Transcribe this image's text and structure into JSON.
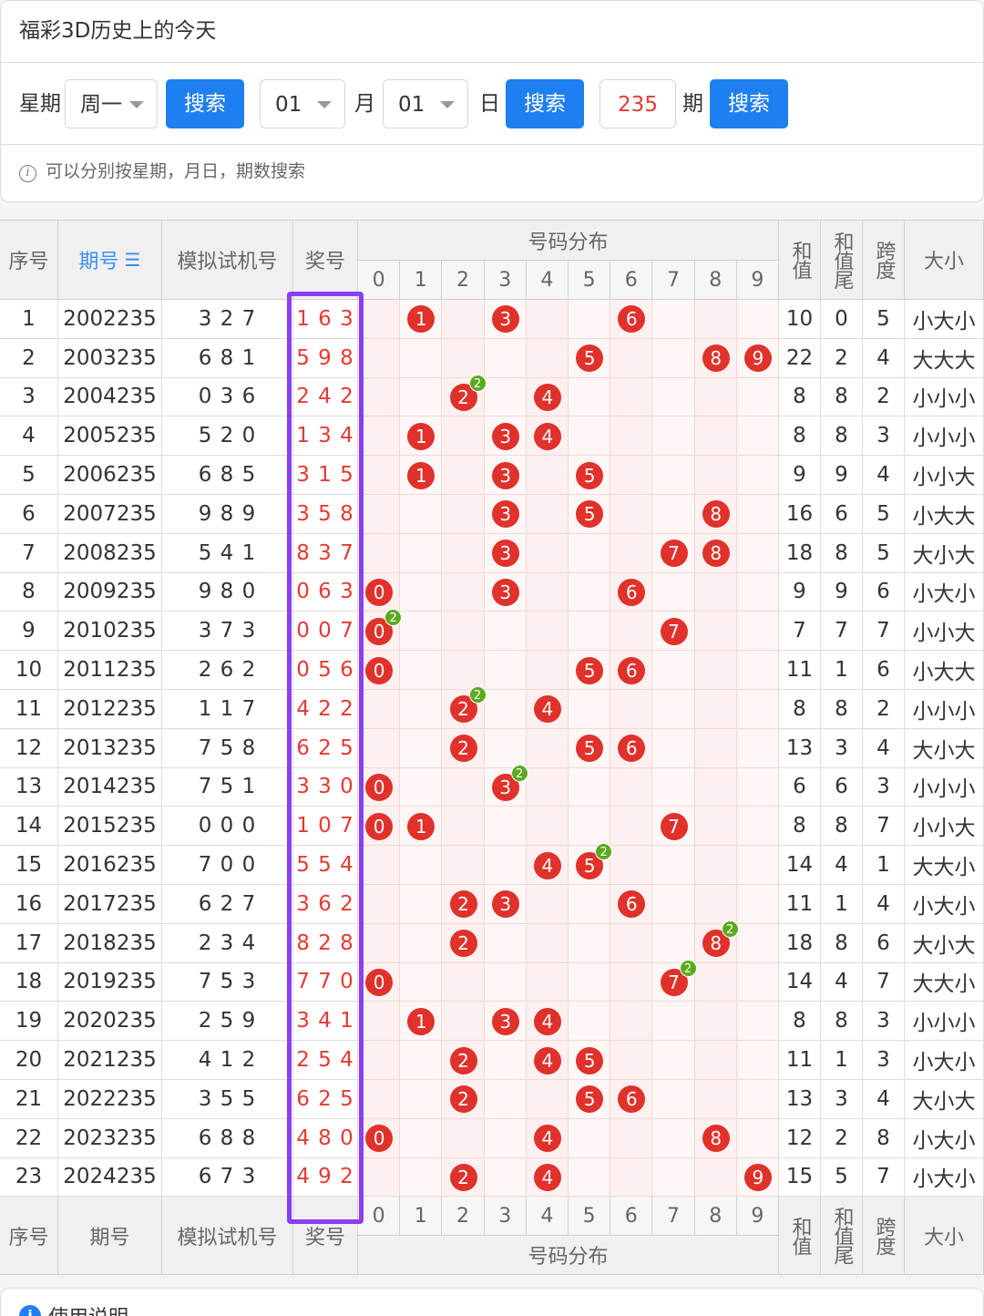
{
  "panel": {
    "title": "福彩3D历史上的今天",
    "weekday_label": "星期",
    "weekday_value": "周一",
    "search_label": "搜索",
    "month_value": "01",
    "month_label": "月",
    "day_value": "01",
    "day_label": "日",
    "issue_value": "235",
    "issue_label": "期",
    "hint": "可以分别按星期，月日，期数搜索"
  },
  "table": {
    "headers": {
      "seq": "序号",
      "issue": "期号",
      "sort_icon": "sort-icon",
      "trial": "模拟试机号",
      "prize": "奖号",
      "dist": "号码分布",
      "digits": [
        "0",
        "1",
        "2",
        "3",
        "4",
        "5",
        "6",
        "7",
        "8",
        "9"
      ],
      "sum": "和值",
      "sum_tail": "和值尾",
      "span": "跨度",
      "size": "大小"
    },
    "footer_headers": {
      "seq": "序号",
      "issue": "期号",
      "trial": "模拟试机号",
      "prize": "奖号",
      "dist": "号码分布",
      "sum": "和值",
      "sum_tail": "和值尾",
      "span": "跨度",
      "size": "大小"
    },
    "rows": [
      {
        "seq": "1",
        "issue": "2002235",
        "trial": "3 2 7",
        "prize": "1 6 3",
        "balls": [
          1,
          3,
          6
        ],
        "badges": [],
        "sum": "10",
        "tail": "0",
        "span": "5",
        "size": "小大小"
      },
      {
        "seq": "2",
        "issue": "2003235",
        "trial": "6 8 1",
        "prize": "5 9 8",
        "balls": [
          5,
          8,
          9
        ],
        "badges": [],
        "sum": "22",
        "tail": "2",
        "span": "4",
        "size": "大大大"
      },
      {
        "seq": "3",
        "issue": "2004235",
        "trial": "0 3 6",
        "prize": "2 4 2",
        "balls": [
          2,
          4
        ],
        "badges": [
          2
        ],
        "sum": "8",
        "tail": "8",
        "span": "2",
        "size": "小小小"
      },
      {
        "seq": "4",
        "issue": "2005235",
        "trial": "5 2 0",
        "prize": "1 3 4",
        "balls": [
          1,
          3,
          4
        ],
        "badges": [],
        "sum": "8",
        "tail": "8",
        "span": "3",
        "size": "小小小"
      },
      {
        "seq": "5",
        "issue": "2006235",
        "trial": "6 8 5",
        "prize": "3 1 5",
        "balls": [
          1,
          3,
          5
        ],
        "badges": [],
        "sum": "9",
        "tail": "9",
        "span": "4",
        "size": "小小大"
      },
      {
        "seq": "6",
        "issue": "2007235",
        "trial": "9 8 9",
        "prize": "3 5 8",
        "balls": [
          3,
          5,
          8
        ],
        "badges": [],
        "sum": "16",
        "tail": "6",
        "span": "5",
        "size": "小大大"
      },
      {
        "seq": "7",
        "issue": "2008235",
        "trial": "5 4 1",
        "prize": "8 3 7",
        "balls": [
          3,
          7,
          8
        ],
        "badges": [],
        "sum": "18",
        "tail": "8",
        "span": "5",
        "size": "大小大"
      },
      {
        "seq": "8",
        "issue": "2009235",
        "trial": "9 8 0",
        "prize": "0 6 3",
        "balls": [
          0,
          3,
          6
        ],
        "badges": [],
        "sum": "9",
        "tail": "9",
        "span": "6",
        "size": "小大小"
      },
      {
        "seq": "9",
        "issue": "2010235",
        "trial": "3 7 3",
        "prize": "0 0 7",
        "balls": [
          0,
          7
        ],
        "badges": [
          0
        ],
        "sum": "7",
        "tail": "7",
        "span": "7",
        "size": "小小大"
      },
      {
        "seq": "10",
        "issue": "2011235",
        "trial": "2 6 2",
        "prize": "0 5 6",
        "balls": [
          0,
          5,
          6
        ],
        "badges": [],
        "sum": "11",
        "tail": "1",
        "span": "6",
        "size": "小大大"
      },
      {
        "seq": "11",
        "issue": "2012235",
        "trial": "1 1 7",
        "prize": "4 2 2",
        "balls": [
          2,
          4
        ],
        "badges": [
          2
        ],
        "sum": "8",
        "tail": "8",
        "span": "2",
        "size": "小小小"
      },
      {
        "seq": "12",
        "issue": "2013235",
        "trial": "7 5 8",
        "prize": "6 2 5",
        "balls": [
          2,
          5,
          6
        ],
        "badges": [],
        "sum": "13",
        "tail": "3",
        "span": "4",
        "size": "大小大"
      },
      {
        "seq": "13",
        "issue": "2014235",
        "trial": "7 5 1",
        "prize": "3 3 0",
        "balls": [
          0,
          3
        ],
        "badges": [
          3
        ],
        "sum": "6",
        "tail": "6",
        "span": "3",
        "size": "小小小"
      },
      {
        "seq": "14",
        "issue": "2015235",
        "trial": "0 0 0",
        "prize": "1 0 7",
        "balls": [
          0,
          1,
          7
        ],
        "badges": [],
        "sum": "8",
        "tail": "8",
        "span": "7",
        "size": "小小大"
      },
      {
        "seq": "15",
        "issue": "2016235",
        "trial": "7 0 0",
        "prize": "5 5 4",
        "balls": [
          4,
          5
        ],
        "badges": [
          5
        ],
        "sum": "14",
        "tail": "4",
        "span": "1",
        "size": "大大小"
      },
      {
        "seq": "16",
        "issue": "2017235",
        "trial": "6 2 7",
        "prize": "3 6 2",
        "balls": [
          2,
          3,
          6
        ],
        "badges": [],
        "sum": "11",
        "tail": "1",
        "span": "4",
        "size": "小大小"
      },
      {
        "seq": "17",
        "issue": "2018235",
        "trial": "2 3 4",
        "prize": "8 2 8",
        "balls": [
          2,
          8
        ],
        "badges": [
          8
        ],
        "sum": "18",
        "tail": "8",
        "span": "6",
        "size": "大小大"
      },
      {
        "seq": "18",
        "issue": "2019235",
        "trial": "7 5 3",
        "prize": "7 7 0",
        "balls": [
          0,
          7
        ],
        "badges": [
          7
        ],
        "sum": "14",
        "tail": "4",
        "span": "7",
        "size": "大大小"
      },
      {
        "seq": "19",
        "issue": "2020235",
        "trial": "2 5 9",
        "prize": "3 4 1",
        "balls": [
          1,
          3,
          4
        ],
        "badges": [],
        "sum": "8",
        "tail": "8",
        "span": "3",
        "size": "小小小"
      },
      {
        "seq": "20",
        "issue": "2021235",
        "trial": "4 1 2",
        "prize": "2 5 4",
        "balls": [
          2,
          4,
          5
        ],
        "badges": [],
        "sum": "11",
        "tail": "1",
        "span": "3",
        "size": "小大小"
      },
      {
        "seq": "21",
        "issue": "2022235",
        "trial": "3 5 5",
        "prize": "6 2 5",
        "balls": [
          2,
          5,
          6
        ],
        "badges": [],
        "sum": "13",
        "tail": "3",
        "span": "4",
        "size": "大小大"
      },
      {
        "seq": "22",
        "issue": "2023235",
        "trial": "6 8 8",
        "prize": "4 8 0",
        "balls": [
          0,
          4,
          8
        ],
        "badges": [],
        "sum": "12",
        "tail": "2",
        "span": "8",
        "size": "小大小"
      },
      {
        "seq": "23",
        "issue": "2024235",
        "trial": "6 7 3",
        "prize": "4 9 2",
        "balls": [
          2,
          4,
          9
        ],
        "badges": [],
        "sum": "15",
        "tail": "5",
        "span": "7",
        "size": "小大小"
      }
    ],
    "badge_text": "2"
  },
  "footer_card": {
    "title": "使用说明"
  },
  "colors": {
    "accent": "#1e7ff0",
    "ball": "#e0312b",
    "badge": "#5aaa1e",
    "highlight": "#8a3ff0",
    "prize_text": "#e53a33"
  }
}
